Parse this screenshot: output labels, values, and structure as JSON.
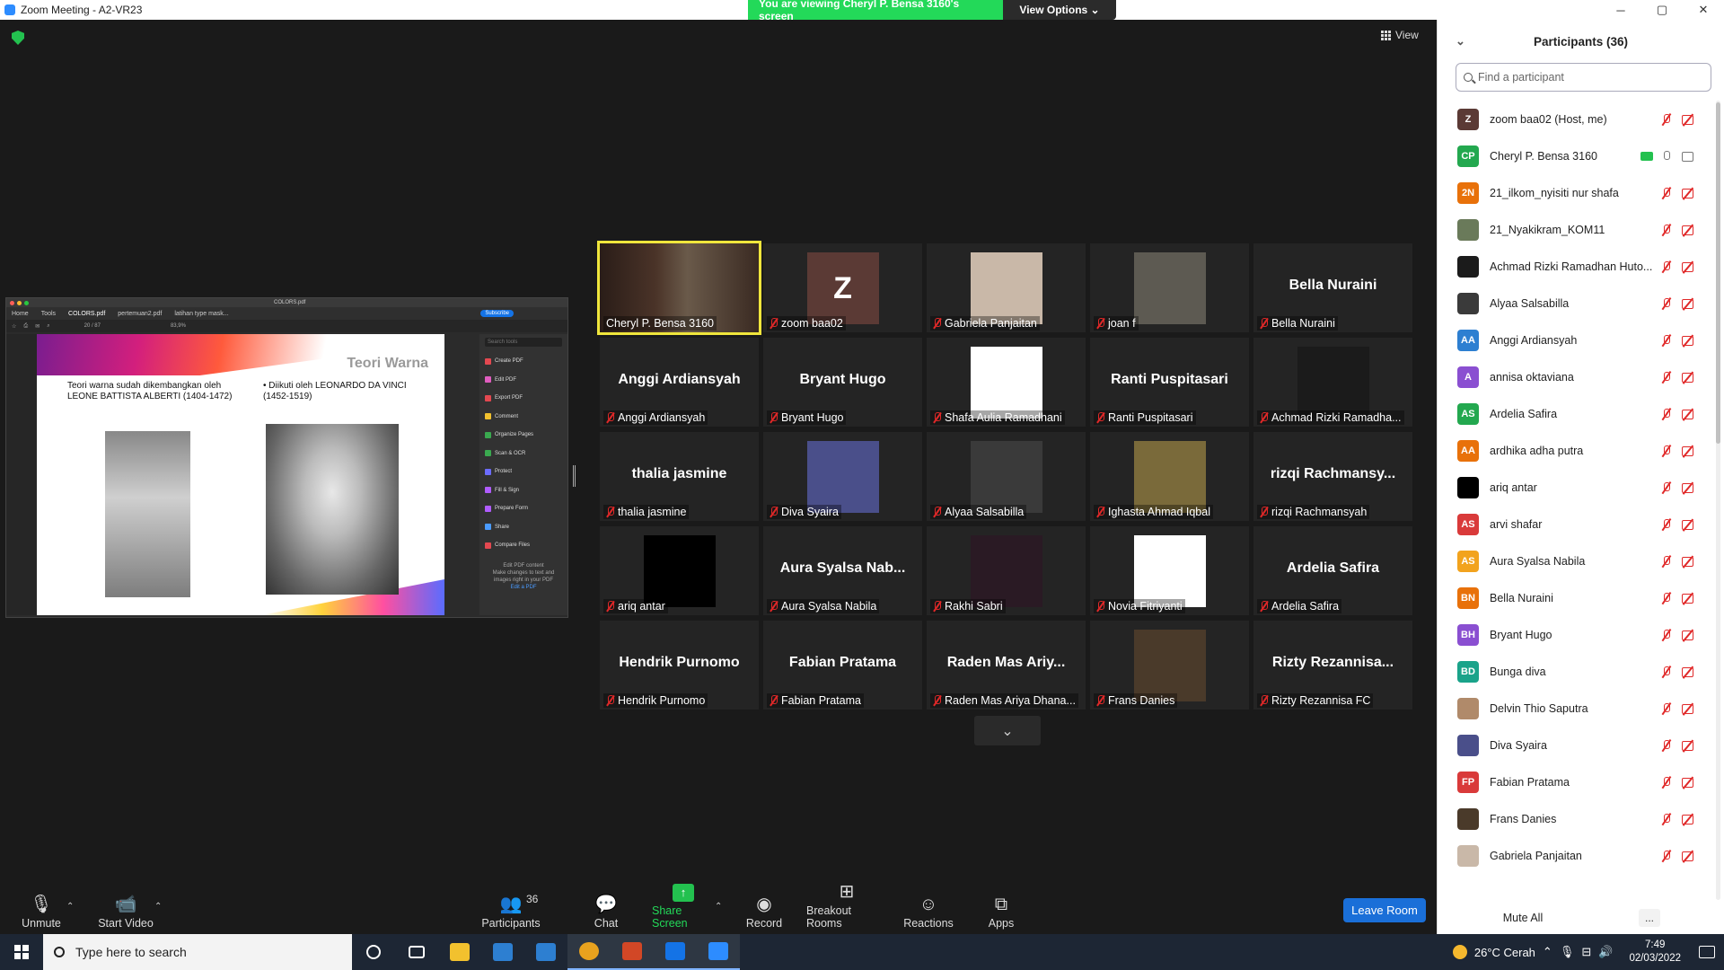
{
  "window": {
    "title": "Zoom Meeting - A2-VR23",
    "controls": [
      "─",
      "▢",
      "✕"
    ]
  },
  "share_banner": {
    "message": "You are viewing Cheryl P. Bensa 3160's screen",
    "view_options": "View Options ⌄"
  },
  "view_button": "View",
  "shared_screen": {
    "tabs": [
      "Home",
      "Tools",
      "COLORS.pdf",
      "pertemuan2.pdf",
      "latihan type mask..."
    ],
    "subscribe": "Subscribe",
    "window_title": "COLORS.pdf",
    "page_indicator": "20 / 87",
    "zoom": "83,9%",
    "slide_title": "Teori Warna",
    "bullet1": "Teori warna sudah dikembangkan oleh LEONE BATTISTA ALBERTI (1404-1472)",
    "bullet2": "• Diikuti oleh LEONARDO DA VINCI (1452-1519)",
    "tools_search": "Search tools",
    "tools": [
      {
        "label": "Create PDF",
        "color": "#e34850"
      },
      {
        "label": "Edit PDF",
        "color": "#e05dbf"
      },
      {
        "label": "Export PDF",
        "color": "#e34850"
      },
      {
        "label": "Comment",
        "color": "#f2c12e"
      },
      {
        "label": "Organize Pages",
        "color": "#3aa94f"
      },
      {
        "label": "Scan & OCR",
        "color": "#3aa94f"
      },
      {
        "label": "Protect",
        "color": "#6c6cff"
      },
      {
        "label": "Fill & Sign",
        "color": "#b05cff"
      },
      {
        "label": "Prepare Form",
        "color": "#b05cff"
      },
      {
        "label": "Share",
        "color": "#4a9bff"
      },
      {
        "label": "Compare Files",
        "color": "#e34850"
      }
    ],
    "promo_title": "Edit PDF content",
    "promo_text": "Make changes to text and images right in your PDF",
    "promo_link": "Edit a PDF"
  },
  "gallery": [
    {
      "label": "Cheryl P. Bensa 3160",
      "type": "photo",
      "color": "#3b2a22",
      "active": true,
      "muted": false
    },
    {
      "label": "zoom baa02",
      "type": "letter",
      "letter": "Z",
      "muted": true
    },
    {
      "label": "Gabriela Panjaitan",
      "type": "photo",
      "color": "#c9b8a8",
      "muted": true
    },
    {
      "label": "joan f",
      "type": "photo",
      "color": "#5d5a52",
      "muted": true
    },
    {
      "label": "Bella Nuraini",
      "type": "name",
      "big": "Bella Nuraini",
      "muted": true
    },
    {
      "label": "Anggi Ardiansyah",
      "type": "name",
      "big": "Anggi Ardiansyah",
      "muted": true
    },
    {
      "label": "Bryant Hugo",
      "type": "name",
      "big": "Bryant Hugo",
      "muted": true
    },
    {
      "label": "Shafa Aulia Ramadhani",
      "type": "photo",
      "color": "#ffffff",
      "muted": true
    },
    {
      "label": "Ranti Puspitasari",
      "type": "name",
      "big": "Ranti Puspitasari",
      "muted": true
    },
    {
      "label": "Achmad Rizki Ramadha...",
      "type": "photo",
      "color": "#1b1b1b",
      "muted": true
    },
    {
      "label": "thalia jasmine",
      "type": "name",
      "big": "thalia jasmine",
      "muted": true
    },
    {
      "label": "Diva Syaira",
      "type": "photo",
      "color": "#4a4f8a",
      "muted": true
    },
    {
      "label": "Alyaa Salsabilla",
      "type": "photo",
      "color": "#3a3a3a",
      "muted": true
    },
    {
      "label": "Ighasta Ahmad Iqbal",
      "type": "photo",
      "color": "#7a6a3a",
      "muted": true
    },
    {
      "label": "rizqi Rachmansyah",
      "type": "name",
      "big": "rizqi  Rachmansy...",
      "muted": true
    },
    {
      "label": "ariq antar",
      "type": "photo",
      "color": "#000000",
      "muted": true
    },
    {
      "label": "Aura Syalsa Nabila",
      "type": "name",
      "big": "Aura Syalsa Nab...",
      "muted": true
    },
    {
      "label": "Rakhi Sabri",
      "type": "photo",
      "color": "#2a1a24",
      "muted": true
    },
    {
      "label": "Novia Fitriyanti",
      "type": "photo",
      "color": "#ffffff",
      "muted": true
    },
    {
      "label": "Ardelia Safira",
      "type": "name",
      "big": "Ardelia Safira",
      "muted": true
    },
    {
      "label": "Hendrik Purnomo",
      "type": "name",
      "big": "Hendrik Purnomo",
      "muted": true
    },
    {
      "label": "Fabian Pratama",
      "type": "name",
      "big": "Fabian Pratama",
      "muted": true
    },
    {
      "label": "Raden Mas Ariya Dhana...",
      "type": "name",
      "big": "Raden  Mas  Ariy...",
      "muted": true
    },
    {
      "label": "Frans Danies",
      "type": "photo",
      "color": "#4a3a2a",
      "muted": true
    },
    {
      "label": "Rizty Rezannisa FC",
      "type": "name",
      "big": "Rizty  Rezannisa...",
      "muted": true
    }
  ],
  "toolbar": {
    "unmute": "Unmute",
    "start_video": "Start Video",
    "participants": "Participants",
    "participants_count": "36",
    "chat": "Chat",
    "share_screen": "Share Screen",
    "record": "Record",
    "breakout": "Breakout Rooms",
    "reactions": "Reactions",
    "apps": "Apps",
    "leave": "Leave Room"
  },
  "participants_panel": {
    "title": "Participants (36)",
    "search_placeholder": "Find a participant",
    "mute_all": "Mute All",
    "more": "...",
    "list": [
      {
        "initials": "Z",
        "name": "zoom baa02 (Host, me)",
        "color": "#5b3a35",
        "status": "off"
      },
      {
        "initials": "CP",
        "name": "Cheryl P. Bensa 3160",
        "color": "#23a84f",
        "status": "sharing"
      },
      {
        "initials": "2N",
        "name": "21_ilkom_nyisiti nur shafa",
        "color": "#e8710a",
        "status": "off"
      },
      {
        "initials": "",
        "name": "21_Nyakikram_KOM11",
        "color": "#6a7a5a",
        "status": "off"
      },
      {
        "initials": "",
        "name": "Achmad Rizki Ramadhan Huto...",
        "color": "#1b1b1b",
        "status": "off"
      },
      {
        "initials": "",
        "name": "Alyaa Salsabilla",
        "color": "#3a3a3a",
        "status": "off"
      },
      {
        "initials": "AA",
        "name": "Anggi Ardiansyah",
        "color": "#2d7fd1",
        "status": "off"
      },
      {
        "initials": "A",
        "name": "annisa oktaviana",
        "color": "#8a4fd1",
        "status": "off"
      },
      {
        "initials": "AS",
        "name": "Ardelia Safira",
        "color": "#23a84f",
        "status": "off"
      },
      {
        "initials": "AA",
        "name": "ardhika adha putra",
        "color": "#e8710a",
        "status": "off"
      },
      {
        "initials": "",
        "name": "ariq antar",
        "color": "#000000",
        "status": "off"
      },
      {
        "initials": "AS",
        "name": "arvi shafar",
        "color": "#d93a3a",
        "status": "off"
      },
      {
        "initials": "AS",
        "name": "Aura Syalsa Nabila",
        "color": "#f2a31e",
        "status": "off"
      },
      {
        "initials": "BN",
        "name": "Bella Nuraini",
        "color": "#e8710a",
        "status": "off"
      },
      {
        "initials": "BH",
        "name": "Bryant Hugo",
        "color": "#8a4fd1",
        "status": "off"
      },
      {
        "initials": "BD",
        "name": "Bunga diva",
        "color": "#1aa38a",
        "status": "off"
      },
      {
        "initials": "",
        "name": "Delvin Thio Saputra",
        "color": "#b08a6a",
        "status": "off"
      },
      {
        "initials": "",
        "name": "Diva Syaira",
        "color": "#4a4f8a",
        "status": "off"
      },
      {
        "initials": "FP",
        "name": "Fabian Pratama",
        "color": "#d93a3a",
        "status": "off"
      },
      {
        "initials": "",
        "name": "Frans Danies",
        "color": "#4a3a2a",
        "status": "off"
      },
      {
        "initials": "",
        "name": "Gabriela Panjaitan",
        "color": "#c9b8a8",
        "status": "off"
      }
    ]
  },
  "taskbar": {
    "search_placeholder": "Type here to search",
    "apps": [
      {
        "name": "task-view",
        "color": "#ffffff"
      },
      {
        "name": "file-explorer",
        "color": "#f2c12e"
      },
      {
        "name": "store",
        "color": "#2d7fd1"
      },
      {
        "name": "mail",
        "color": "#2d7fd1"
      },
      {
        "name": "chrome",
        "color": "#e8a21e"
      },
      {
        "name": "powerpoint",
        "color": "#d24726"
      },
      {
        "name": "teamviewer",
        "color": "#1473e6"
      },
      {
        "name": "zoom",
        "color": "#2d8cff"
      }
    ],
    "weather": "26°C  Cerah",
    "time": "7:49",
    "date": "02/03/2022"
  }
}
